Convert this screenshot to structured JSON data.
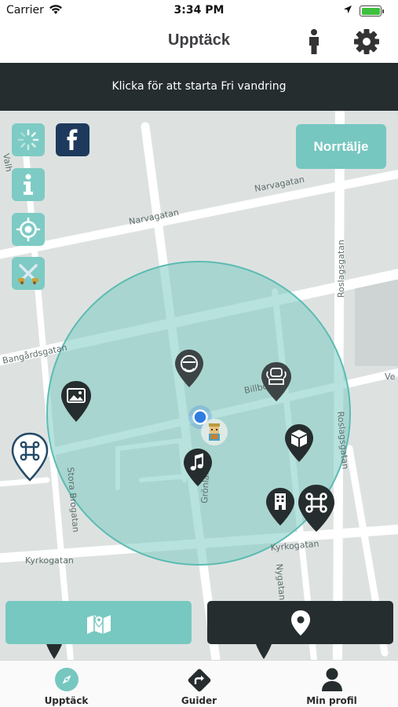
{
  "status_bar": {
    "carrier": "Carrier",
    "time": "3:34 PM",
    "battery_color": "#3ec13e"
  },
  "nav": {
    "title": "Upptäck",
    "icons": [
      "person-icon",
      "gear-icon"
    ]
  },
  "banner": {
    "text": "Klicka för att starta Fri vandring"
  },
  "map": {
    "city_button": "Norrtälje",
    "street_labels": [
      "Narvagatan",
      "Narvagatan",
      "Bangårdsgatan",
      "Roslagsgatan",
      "Roslagsgatan",
      "Billbo",
      "Stora Brogatan",
      "Grönlan",
      "Kyrkogatan",
      "Kyrkogatan",
      "Nygatan",
      "Ve",
      "Valh"
    ],
    "side_buttons": [
      "loading-icon",
      "info-icon",
      "locate-icon",
      "swords-icon"
    ],
    "pins": [
      "gallery-pin",
      "guide-pin",
      "monument-pin",
      "music-pin",
      "box-pin",
      "building-pin",
      "command-pin",
      "command-outline-pin"
    ],
    "colors": {
      "accent": "#76c7c0",
      "dark": "#262d2f",
      "user_dot": "#2f7de1"
    }
  },
  "bottom_buttons": {
    "left_icon": "map-icon",
    "right_icon": "location-pin-icon"
  },
  "tabs": [
    {
      "label": "Upptäck",
      "icon": "compass-icon"
    },
    {
      "label": "Guider",
      "icon": "route-icon"
    },
    {
      "label": "Min profil",
      "icon": "profile-icon"
    }
  ]
}
